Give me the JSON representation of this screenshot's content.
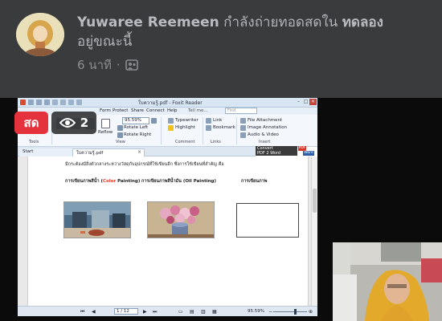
{
  "post": {
    "author_name": "Yuwaree Reemeen",
    "status_text": " กำลังถ่ายทอดสดใน ",
    "group_name": "ทดลอง",
    "status_suffix": "อยู่ขณะนี้",
    "time_ago": "6 นาที",
    "separator": "·"
  },
  "live": {
    "live_label": "สด",
    "viewer_count": "2"
  },
  "foxit": {
    "window_title": "ใบความรู้.pdf - Foxit Reader",
    "menu": [
      "Form",
      "Protect",
      "Share",
      "Connect",
      "Help"
    ],
    "tell_me": "Tell me...",
    "search_placeholder": "Find",
    "ribbon": {
      "zoom_value": "95.59%",
      "rotate_left": "Rotate Left",
      "rotate_right": "Rotate Right",
      "typewriter": "Typewriter",
      "highlight": "Highlight",
      "link": "Link",
      "bookmark": "Bookmark",
      "file_attachment": "File Attachment",
      "image_annotation": "Image Annotation",
      "audio_video": "Audio & Video",
      "reflow": "Reflow",
      "groups": [
        "Tools",
        "View",
        "Comment",
        "Links",
        "Insert"
      ]
    },
    "convert_label_1": "Convert",
    "convert_label_2": "PDF 2 Word",
    "pdf_badge": "PDF",
    "word_badge": "Word",
    "tabs": {
      "start": "Start",
      "doc": "ใบความรู้.pdf"
    },
    "document": {
      "intro": "มีกระต้องมีสิ่งตัวกลางระหว่างวัสดุกับอุปกรณ์ที่ใช้เขียนอีก ซึ่งการใช้เขียนที่สำคัญ คือ",
      "heading1_pre": "การเขียนภาพสีน้ำ (",
      "heading1_color": "Color",
      "heading1_post": " Painting)",
      "heading2": "การเขียนภาพสีน้ำมัน (Oil Painting)",
      "heading3": "การเขียนภาพ"
    },
    "status": {
      "page": "1 / 12",
      "zoom": "95.59%"
    }
  },
  "colors": {
    "accent_live": "#e4333c",
    "facebook_card": "#3a3b3c"
  }
}
